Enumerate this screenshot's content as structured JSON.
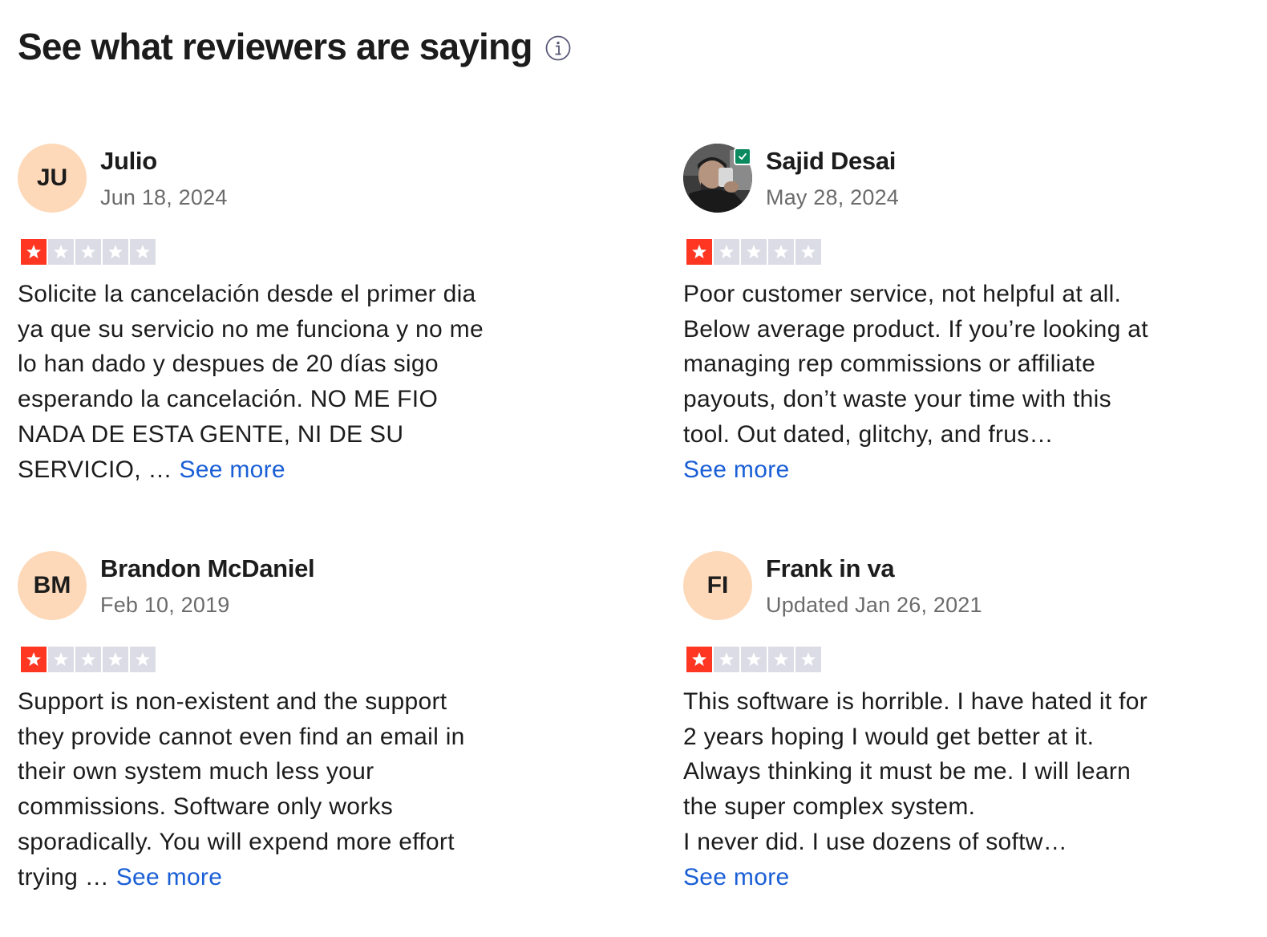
{
  "header": {
    "title": "See what reviewers are saying",
    "info_icon": "info-circle-icon"
  },
  "colors": {
    "star_filled": "#ff3722",
    "star_empty": "#dcdce6",
    "avatar_bg": "#fdd9b9",
    "link": "#1a5fd6",
    "verified": "#0c8a5f"
  },
  "reviews": [
    {
      "initials": "JU",
      "name": "Julio",
      "date": "Jun 18, 2024",
      "rating": 1,
      "rating_max": 5,
      "lines": [
        "Solicite la cancelación desde el primer dia",
        "ya que su servicio no me funciona y no me",
        "lo han dado y despues de 20 días sigo",
        "esperando la cancelación. NO ME FIO",
        "NADA DE ESTA GENTE, NI DE SU",
        "SERVICIO, … "
      ],
      "see_more": "See more"
    },
    {
      "avatar": "photo",
      "verified_icon": "verified-check-icon",
      "name": "Sajid Desai",
      "date": "May 28, 2024",
      "rating": 1,
      "rating_max": 5,
      "lines": [
        "Poor customer service, not helpful at all.",
        "Below average product. If you’re looking at",
        "managing rep commissions or affiliate",
        "payouts, don’t waste your time with this",
        "tool. Out dated, glitchy, and frus…"
      ],
      "see_more": "See more"
    },
    {
      "initials": "BM",
      "name": "Brandon McDaniel",
      "date": "Feb 10, 2019",
      "rating": 1,
      "rating_max": 5,
      "lines": [
        "Support is non-existent and the support",
        "they provide cannot even find an email in",
        "their own system much less your",
        "commissions. Software only works",
        "sporadically. You will expend more effort",
        "trying … "
      ],
      "see_more": "See more"
    },
    {
      "initials": "FI",
      "name": "Frank in va",
      "date": "Updated Jan 26, 2021",
      "rating": 1,
      "rating_max": 5,
      "lines": [
        "This software is horrible. I have hated it for",
        "2 years hoping I would get better at it.",
        "Always thinking it must be me. I will learn",
        "the super complex system.",
        "I never did. I use dozens of softw…"
      ],
      "see_more": "See more"
    }
  ]
}
